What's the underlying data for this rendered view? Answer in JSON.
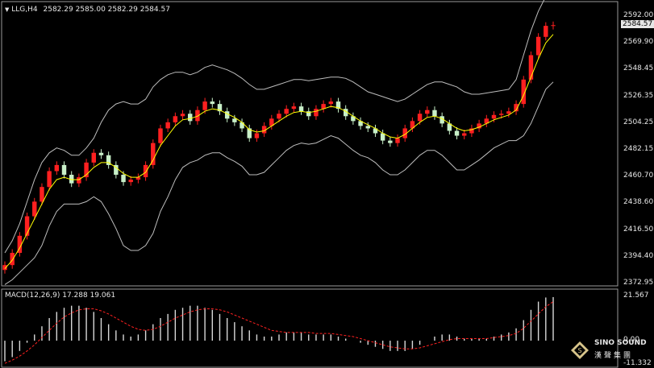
{
  "header": {
    "symbol": "LLG,H4",
    "ohlc": "2582.29 2585.00 2582.29 2584.57"
  },
  "price_axis": {
    "labels": [
      "2592.00",
      "2569.90",
      "2548.45",
      "2526.35",
      "2504.25",
      "2482.15",
      "2460.70",
      "2438.60",
      "2416.50",
      "2394.40",
      "2372.95"
    ],
    "current": "2584.57"
  },
  "macd": {
    "label": "MACD(12,26,9) 17.288 19.061",
    "axis_labels": [
      "21.567",
      "0.00",
      "-11.332"
    ]
  },
  "logo": {
    "name": "SINO SOUND",
    "cn": "漢聲集團"
  },
  "colors": {
    "bull": "#ff2020",
    "bear": "#c8f0c8",
    "ma": "#ffff00",
    "band": "#bdbdbd",
    "signal": "#ff2020"
  },
  "chart_data": [
    {
      "type": "candlestick",
      "title": "LLG,H4",
      "y_axis_range": [
        2372.95,
        2592.0
      ],
      "series": [
        {
          "name": "price",
          "values": [
            2388,
            2398,
            2412,
            2428,
            2440,
            2452,
            2465,
            2470,
            2462,
            2455,
            2460,
            2472,
            2480,
            2478,
            2470,
            2462,
            2456,
            2458,
            2460,
            2470,
            2488,
            2500,
            2505,
            2510,
            2512,
            2506,
            2515,
            2522,
            2520,
            2514,
            2508,
            2505,
            2500,
            2492,
            2496,
            2502,
            2508,
            2512,
            2516,
            2518,
            2514,
            2510,
            2516,
            2520,
            2522,
            2516,
            2510,
            2506,
            2502,
            2500,
            2496,
            2490,
            2488,
            2492,
            2500,
            2506,
            2512,
            2515,
            2510,
            2504,
            2498,
            2494,
            2496,
            2500,
            2504,
            2508,
            2511,
            2512,
            2514,
            2520,
            2540,
            2560,
            2575,
            2584,
            2584.57
          ]
        },
        {
          "name": "ma",
          "values": [
            2385,
            2392,
            2402,
            2414,
            2426,
            2438,
            2450,
            2458,
            2460,
            2458,
            2458,
            2462,
            2468,
            2472,
            2472,
            2468,
            2463,
            2460,
            2460,
            2464,
            2474,
            2486,
            2494,
            2502,
            2507,
            2508,
            2510,
            2514,
            2516,
            2515,
            2512,
            2509,
            2505,
            2499,
            2497,
            2498,
            2502,
            2506,
            2510,
            2513,
            2514,
            2513,
            2514,
            2516,
            2518,
            2517,
            2514,
            2510,
            2506,
            2503,
            2500,
            2496,
            2493,
            2492,
            2495,
            2500,
            2505,
            2509,
            2510,
            2508,
            2504,
            2500,
            2498,
            2499,
            2501,
            2504,
            2507,
            2509,
            2511,
            2515,
            2527,
            2542,
            2557,
            2570,
            2577
          ]
        },
        {
          "name": "upper",
          "values": [
            2398,
            2408,
            2422,
            2440,
            2458,
            2472,
            2480,
            2484,
            2482,
            2478,
            2478,
            2484,
            2492,
            2505,
            2515,
            2520,
            2522,
            2520,
            2520,
            2524,
            2534,
            2540,
            2544,
            2546,
            2546,
            2544,
            2546,
            2550,
            2552,
            2550,
            2548,
            2545,
            2541,
            2536,
            2532,
            2532,
            2534,
            2536,
            2538,
            2540,
            2540,
            2539,
            2540,
            2541,
            2542,
            2542,
            2541,
            2538,
            2534,
            2530,
            2528,
            2526,
            2524,
            2522,
            2524,
            2528,
            2532,
            2536,
            2538,
            2538,
            2536,
            2534,
            2530,
            2528,
            2528,
            2529,
            2530,
            2531,
            2532,
            2540,
            2560,
            2580,
            2596,
            2608,
            2616
          ]
        },
        {
          "name": "lower",
          "values": [
            2372,
            2376,
            2382,
            2388,
            2394,
            2404,
            2420,
            2432,
            2438,
            2438,
            2438,
            2440,
            2444,
            2440,
            2430,
            2418,
            2404,
            2400,
            2400,
            2404,
            2414,
            2432,
            2444,
            2458,
            2468,
            2472,
            2474,
            2478,
            2480,
            2480,
            2476,
            2473,
            2469,
            2462,
            2462,
            2464,
            2470,
            2476,
            2482,
            2486,
            2488,
            2487,
            2488,
            2491,
            2494,
            2492,
            2487,
            2482,
            2478,
            2476,
            2472,
            2466,
            2462,
            2462,
            2466,
            2472,
            2478,
            2482,
            2482,
            2478,
            2472,
            2466,
            2466,
            2470,
            2474,
            2479,
            2484,
            2487,
            2490,
            2490,
            2494,
            2504,
            2518,
            2532,
            2538
          ]
        }
      ]
    },
    {
      "type": "bar",
      "title": "MACD(12,26,9)",
      "y_axis_range": [
        -11.332,
        21.567
      ],
      "series": [
        {
          "name": "macd",
          "values": [
            -10,
            -8,
            -5,
            -1,
            3,
            7,
            11,
            14,
            16,
            17,
            17,
            16,
            14,
            11,
            8,
            5,
            3,
            2,
            3,
            5,
            8,
            11,
            13,
            15,
            16,
            17,
            17,
            16,
            15,
            13,
            11,
            9,
            7,
            5,
            3,
            2,
            2,
            3,
            4,
            4,
            4,
            3,
            3,
            3,
            3,
            2,
            1,
            0,
            -1,
            -2,
            -3,
            -4,
            -5,
            -5,
            -5,
            -4,
            -2,
            0,
            2,
            3,
            3,
            2,
            1,
            1,
            1,
            1,
            2,
            3,
            4,
            6,
            10,
            15,
            19,
            21,
            21.2
          ]
        },
        {
          "name": "signal",
          "values": [
            -11,
            -9.5,
            -7.5,
            -5,
            -2,
            1.5,
            5,
            8.5,
            11.5,
            13.5,
            15,
            15.5,
            15.5,
            14.5,
            13,
            11,
            9,
            7,
            5.5,
            5,
            5.5,
            7,
            9,
            11,
            12.5,
            14,
            15,
            15.5,
            15.5,
            15,
            14,
            12.5,
            11,
            9.5,
            8,
            6.5,
            5,
            4.5,
            4,
            4,
            4,
            4,
            3.5,
            3.5,
            3.5,
            3,
            2.5,
            2,
            1,
            0,
            -1,
            -2,
            -3,
            -3.5,
            -4,
            -4,
            -3.5,
            -2.5,
            -1.5,
            -0.5,
            0.5,
            1,
            1,
            1,
            1,
            1,
            1.5,
            2,
            2.5,
            3.5,
            6,
            9.5,
            13,
            16.5,
            19
          ]
        }
      ]
    }
  ]
}
